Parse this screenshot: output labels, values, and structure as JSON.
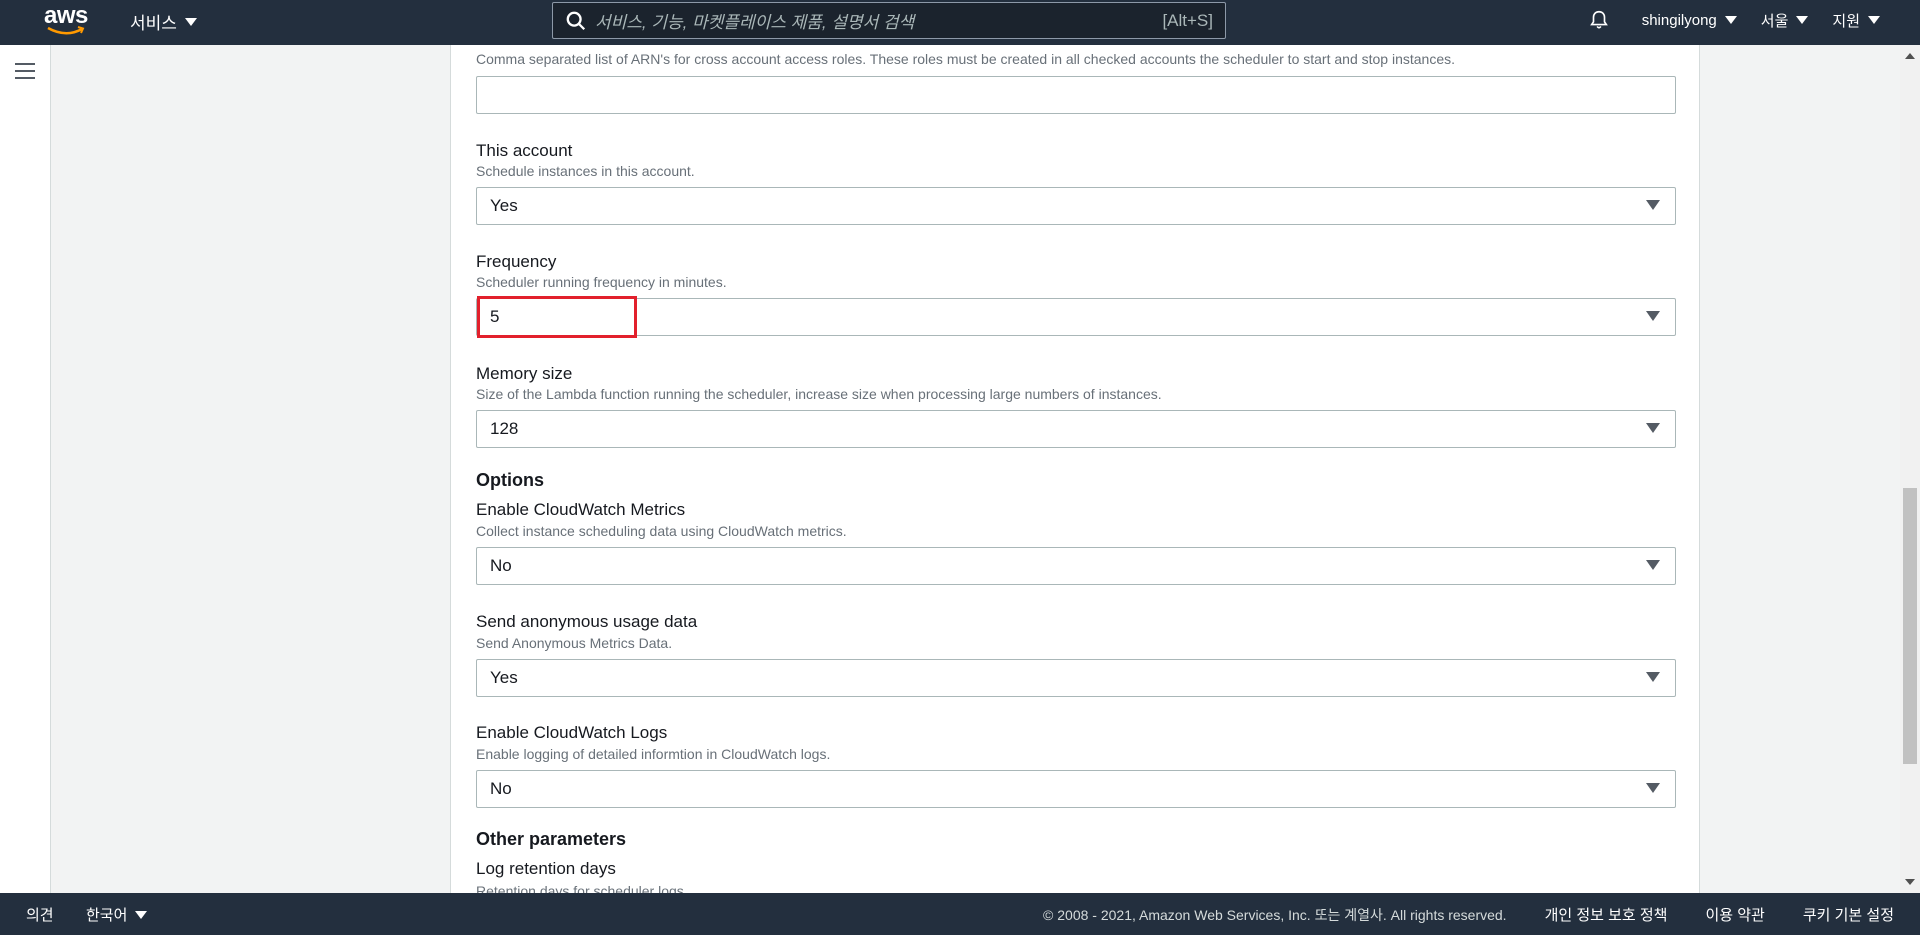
{
  "nav": {
    "logo_text": "aws",
    "services_label": "서비스",
    "search_placeholder": "서비스, 기능, 마켓플레이스 제품, 설명서 검색",
    "search_shortcut": "[Alt+S]",
    "user": "shingilyong",
    "region": "서울",
    "support": "지원"
  },
  "form": {
    "cross_account_desc": "Comma separated list of ARN's for cross account access roles. These roles must be created in all checked accounts the scheduler to start and stop instances.",
    "cross_account_value": "",
    "this_account": {
      "label": "This account",
      "desc": "Schedule instances in this account.",
      "value": "Yes"
    },
    "frequency": {
      "label": "Frequency",
      "desc": "Scheduler running frequency in minutes.",
      "value": "5"
    },
    "memory_size": {
      "label": "Memory size",
      "desc": "Size of the Lambda function running the scheduler, increase size when processing large numbers of instances.",
      "value": "128"
    },
    "options_title": "Options",
    "cloudwatch_metrics": {
      "label": "Enable CloudWatch Metrics",
      "desc": "Collect instance scheduling data using CloudWatch metrics.",
      "value": "No"
    },
    "anonymous_data": {
      "label": "Send anonymous usage data",
      "desc": "Send Anonymous Metrics Data.",
      "value": "Yes"
    },
    "cloudwatch_logs": {
      "label": "Enable CloudWatch Logs",
      "desc": "Enable logging of detailed informtion in CloudWatch logs.",
      "value": "No"
    },
    "other_title": "Other parameters",
    "log_retention": {
      "label": "Log retention days",
      "desc": "Retention days for scheduler logs."
    }
  },
  "footer": {
    "feedback": "의견",
    "language": "한국어",
    "copyright": "© 2008 - 2021, Amazon Web Services, Inc. 또는 계열사. All rights reserved.",
    "privacy": "개인 정보 보호 정책",
    "terms": "이용 약관",
    "cookies": "쿠키 기본 설정"
  },
  "colors": {
    "nav_bg": "#232f3e",
    "highlight": "#e2202c",
    "page_bg": "#f2f3f3"
  }
}
